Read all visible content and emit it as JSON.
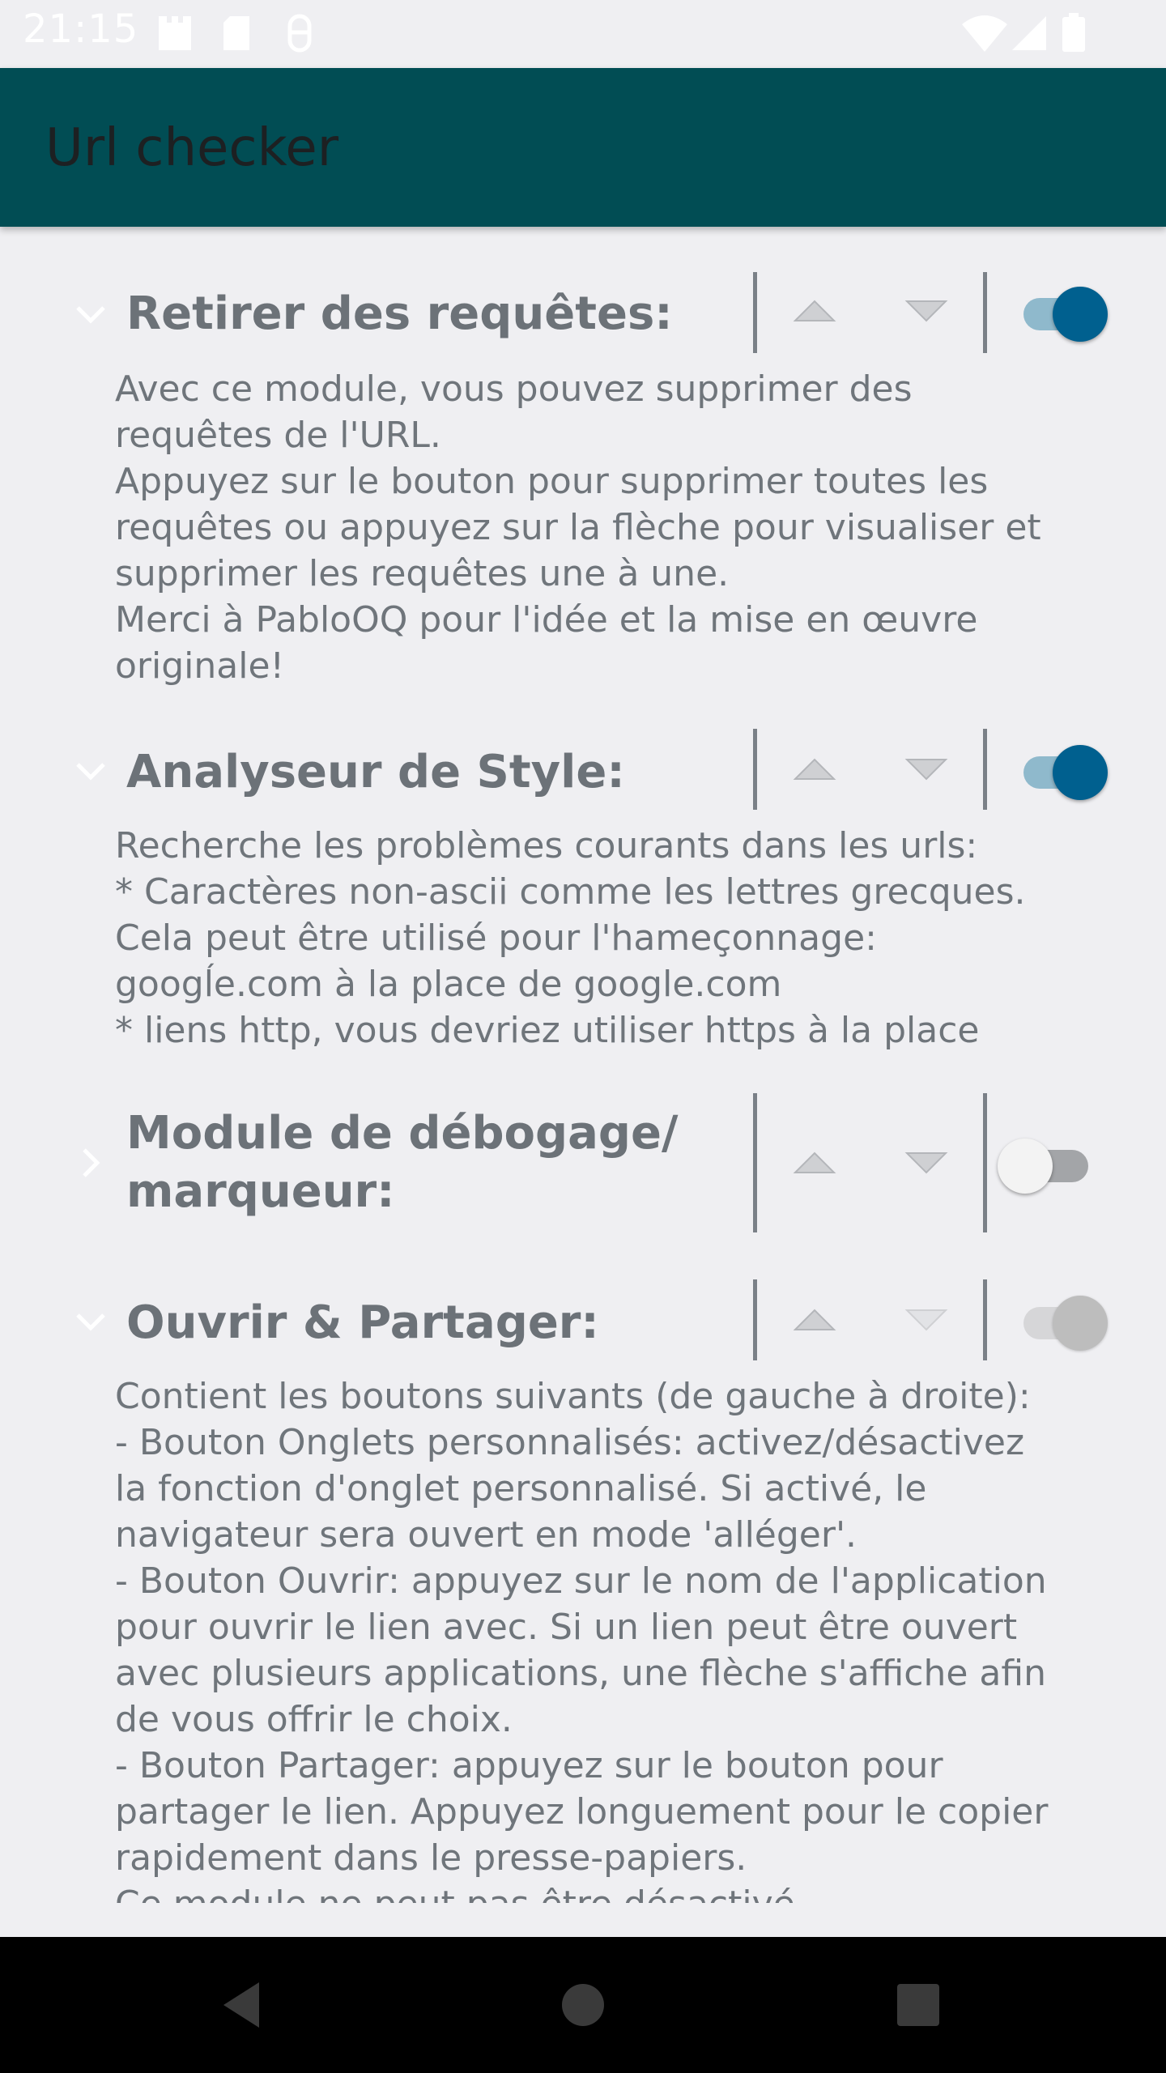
{
  "status_bar": {
    "time": "21:15",
    "icons": [
      "sd-card-icon",
      "sd-card-icon",
      "debug-icon",
      "wifi-icon",
      "signal-icon",
      "battery-icon"
    ]
  },
  "app_bar": {
    "title": "Url checker"
  },
  "modules": [
    {
      "title_lines": [
        "Retirer des requêtes:"
      ],
      "expanded": true,
      "enabled": true,
      "description_lines": [
        "Avec ce module, vous pouvez supprimer des",
        "requêtes de l'URL.",
        "Appuyez sur le bouton pour supprimer toutes les",
        "requêtes ou appuyez sur la flèche pour visualiser et",
        "supprimer les requêtes une à une.",
        "Merci à PabloOQ pour l'idée et la mise en œuvre",
        "originale!"
      ]
    },
    {
      "title_lines": [
        "Analyseur de Style:"
      ],
      "expanded": true,
      "enabled": true,
      "description_lines": [
        "Recherche les problèmes courants dans les urls:",
        "* Caractères non-ascii comme les lettres grecques.",
        "Cela peut être utilisé pour l'hameçonnage:",
        "googĺe.com à la place de google.com",
        "* liens http, vous devriez utiliser https à la place"
      ]
    },
    {
      "title_lines": [
        "Module de débogage/",
        "marqueur:"
      ],
      "expanded": false,
      "enabled": false,
      "description_lines": []
    },
    {
      "title_lines": [
        "Ouvrir & Partager:"
      ],
      "expanded": true,
      "enabled": true,
      "toggle_disabled": true,
      "description_lines": [
        "Contient les boutons suivants (de gauche à droite):",
        "- Bouton Onglets personnalisés: activez/désactivez",
        "la fonction d'onglet personnalisé. Si activé, le",
        "navigateur sera ouvert en mode 'alléger'.",
        "- Bouton Ouvrir: appuyez sur le nom de l'application",
        "pour ouvrir le lien avec. Si un lien peut être ouvert",
        "avec plusieurs applications, une flèche s'affiche afin",
        "de vous offrir le choix.",
        "- Bouton Partager: appuyez sur le bouton pour",
        "partager le lien. Appuyez longuement pour le copier",
        "rapidement dans le presse-papiers.",
        "Ce module ne peut pas être désactivé."
      ]
    }
  ],
  "colors": {
    "app_bar": "#014d54",
    "background": "#efeff2",
    "toggle_on_thumb": "#00608f",
    "toggle_on_track": "#8fb9cc",
    "toggle_off_thumb": "#f3f3f3",
    "toggle_off_track": "#a3a5a8",
    "toggle_disabled_thumb": "#bdbdbd",
    "toggle_disabled_track": "#d6d6d8"
  },
  "nav_bar": {
    "buttons": [
      "back-icon",
      "home-icon",
      "recents-icon"
    ]
  }
}
